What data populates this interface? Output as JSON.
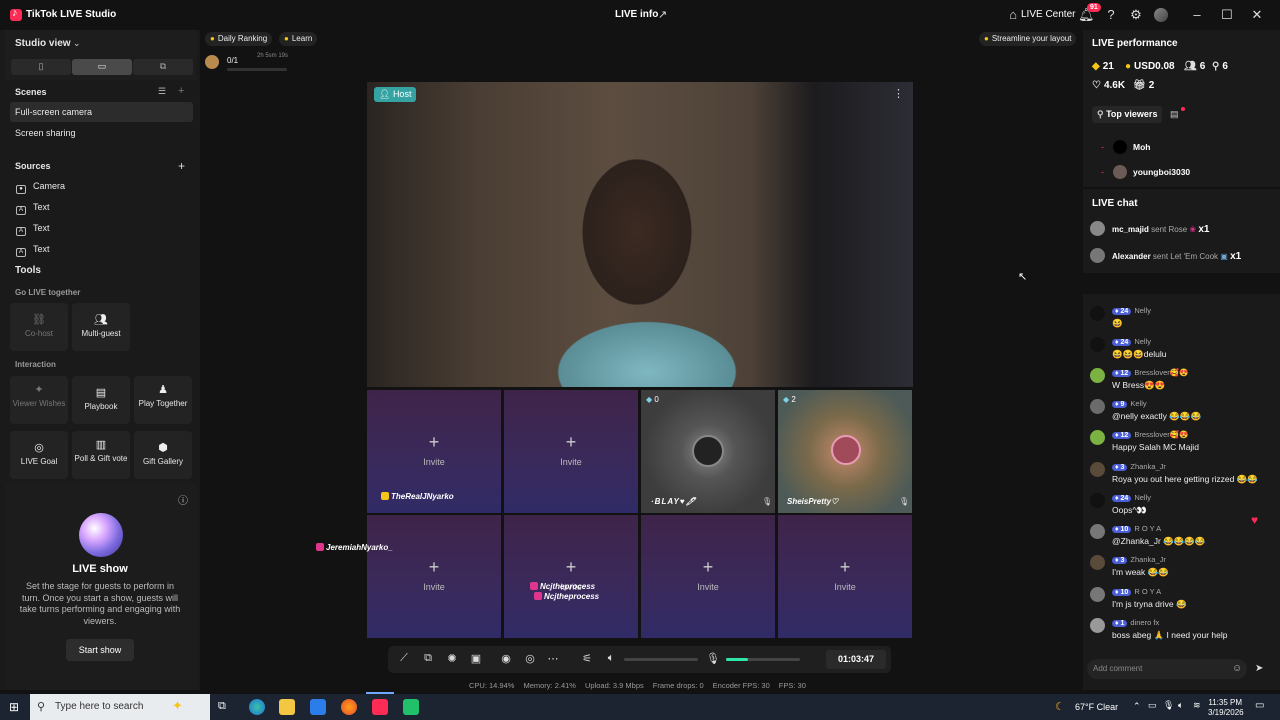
{
  "window": {
    "app_title": "TikTok LIVE Studio",
    "center_title": "LIVE info",
    "live_center": "LIVE Center",
    "notification_count": "91"
  },
  "left": {
    "studio_view": "Studio view",
    "scenes_label": "Scenes",
    "scenes": [
      "Full-screen camera",
      "Screen sharing"
    ],
    "sources_label": "Sources",
    "sources": [
      "Camera",
      "Text",
      "Text",
      "Text"
    ],
    "tools_label": "Tools",
    "go_live_together": "Go LIVE together",
    "tools_row1": [
      {
        "label": "Co-host",
        "icon": "link-icon"
      },
      {
        "label": "Multi-guest",
        "icon": "people-icon"
      }
    ],
    "interaction_label": "Interaction",
    "tools_row2": [
      {
        "label": "Viewer Wishes",
        "icon": "wish-icon"
      },
      {
        "label": "Playbook",
        "icon": "book-icon"
      },
      {
        "label": "Play Together",
        "icon": "play-together-icon"
      }
    ],
    "tools_row3": [
      {
        "label": "LIVE Goal",
        "icon": "goal-icon"
      },
      {
        "label": "Poll & Gift vote",
        "icon": "poll-icon"
      },
      {
        "label": "Gift Gallery",
        "icon": "gift-gallery-icon"
      }
    ],
    "live_show_title": "LIVE show",
    "live_show_desc": "Set the stage for guests to perform in turn. Once you start a show, guests will take turns performing and engaging with viewers.",
    "start_show": "Start show"
  },
  "center": {
    "chips": [
      "Daily Ranking",
      "Learn"
    ],
    "goal_value": "0/1",
    "goal_time": "2h 5sm 19s",
    "streamline": "Streamline your layout",
    "host_tag": "Host",
    "invite": "Invite",
    "guest1": "TheRealJNyarko",
    "guest2_count": "0",
    "guest2_name": "·BLAY♥🖊",
    "guest3_count": "2",
    "guest3_name": "SheisPretty♡",
    "floating_name1": "JeremiahNyarko_",
    "floating_name2": "Ncjtheprocess",
    "floating_name3": "Ncjtheprocess",
    "timer": "01:03:47",
    "mic_level": 0.3,
    "stats": {
      "cpu": "CPU: 14.94%",
      "memory": "Memory: 2.41%",
      "upload": "Upload: 3.9 Mbps",
      "frame_drops": "Frame drops: 0",
      "encoder_fps": "Encoder FPS: 30",
      "fps": "FPS: 30"
    }
  },
  "right": {
    "performance_title": "LIVE performance",
    "diamonds": "21",
    "usd": "USD0.08",
    "viewers": "6",
    "new_followers": "6",
    "likes": "4.6K",
    "gifts": "2",
    "top_viewers": "Top viewers",
    "viewers_list": [
      {
        "rank": "-",
        "name": "Moh"
      },
      {
        "rank": "-",
        "name": "youngboi3030"
      }
    ],
    "chat_title": "LIVE chat",
    "gift_events": [
      {
        "user": "mc_majid",
        "text": "sent Rose",
        "count": "x1"
      },
      {
        "user": "Alexander",
        "text": "sent Let 'Em Cook",
        "count": "x1"
      }
    ],
    "messages": [
      {
        "level": "24",
        "user": "Nelly",
        "text": "😆"
      },
      {
        "level": "24",
        "user": "Nelly",
        "text": "😆😆😆delulu"
      },
      {
        "level": "12",
        "user": "Bresslover🥰😍",
        "text": "W Bress😍😍"
      },
      {
        "level": "9",
        "user": "Kelly",
        "text": "@nelly exactly 😂😂😂"
      },
      {
        "level": "12",
        "user": "Bresslover🥰😍",
        "text": "Happy Salah MC Majid"
      },
      {
        "level": "3",
        "user": "Zhanka_Jr",
        "text": "Roya you out here getting rizzed 😂😂"
      },
      {
        "level": "24",
        "user": "Nelly",
        "text": "Oops^👀"
      },
      {
        "level": "10",
        "user": "R O Y A",
        "text": "@Zhanka_Jr 😂😂😂😂"
      },
      {
        "level": "3",
        "user": "Zhanka_Jr",
        "text": "I'm weak 😂😂"
      },
      {
        "level": "10",
        "user": "R O Y A",
        "text": "I'm js tryna drive 😂"
      },
      {
        "level": "1",
        "user": "dinero fx",
        "text": "boss abeg 🙏 I need your help"
      }
    ],
    "add_comment": "Add comment"
  },
  "taskbar": {
    "search_placeholder": "Type here to search",
    "weather": "67°F Clear",
    "time": "11:35 PM",
    "date": "3/19/2026"
  }
}
